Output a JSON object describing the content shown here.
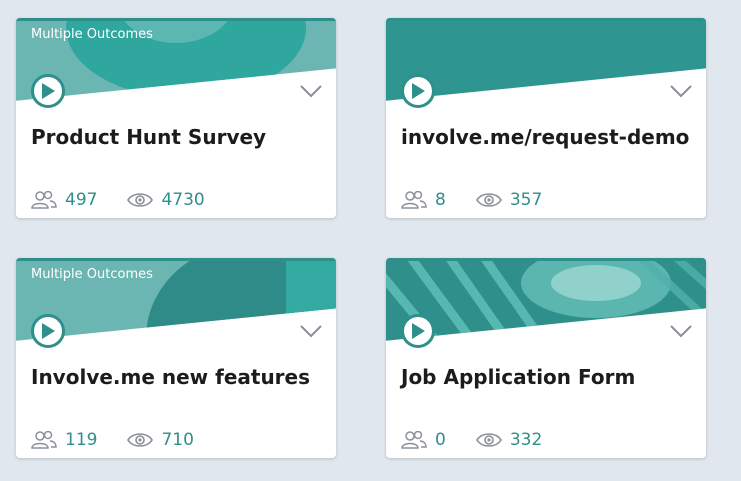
{
  "colors": {
    "page_bg": "#e1e7ef",
    "accent": "#2e8f8b",
    "thumbnail_teal": "#32a59d",
    "icon_gray": "#8a8f98"
  },
  "icons": {
    "participants": "participants-icon",
    "views": "eye-icon",
    "play": "play-icon",
    "expand": "chevron-down-icon"
  },
  "projects": [
    {
      "badge": "Multiple Outcomes",
      "title": "Product Hunt Survey",
      "participants": "497",
      "views": "4730"
    },
    {
      "badge": "",
      "title": "involve.me/request-demo",
      "participants": "8",
      "views": "357"
    },
    {
      "badge": "Multiple Outcomes",
      "title": "Involve.me new features",
      "participants": "119",
      "views": "710"
    },
    {
      "badge": "",
      "title": "Job Application Form",
      "participants": "0",
      "views": "332"
    }
  ]
}
